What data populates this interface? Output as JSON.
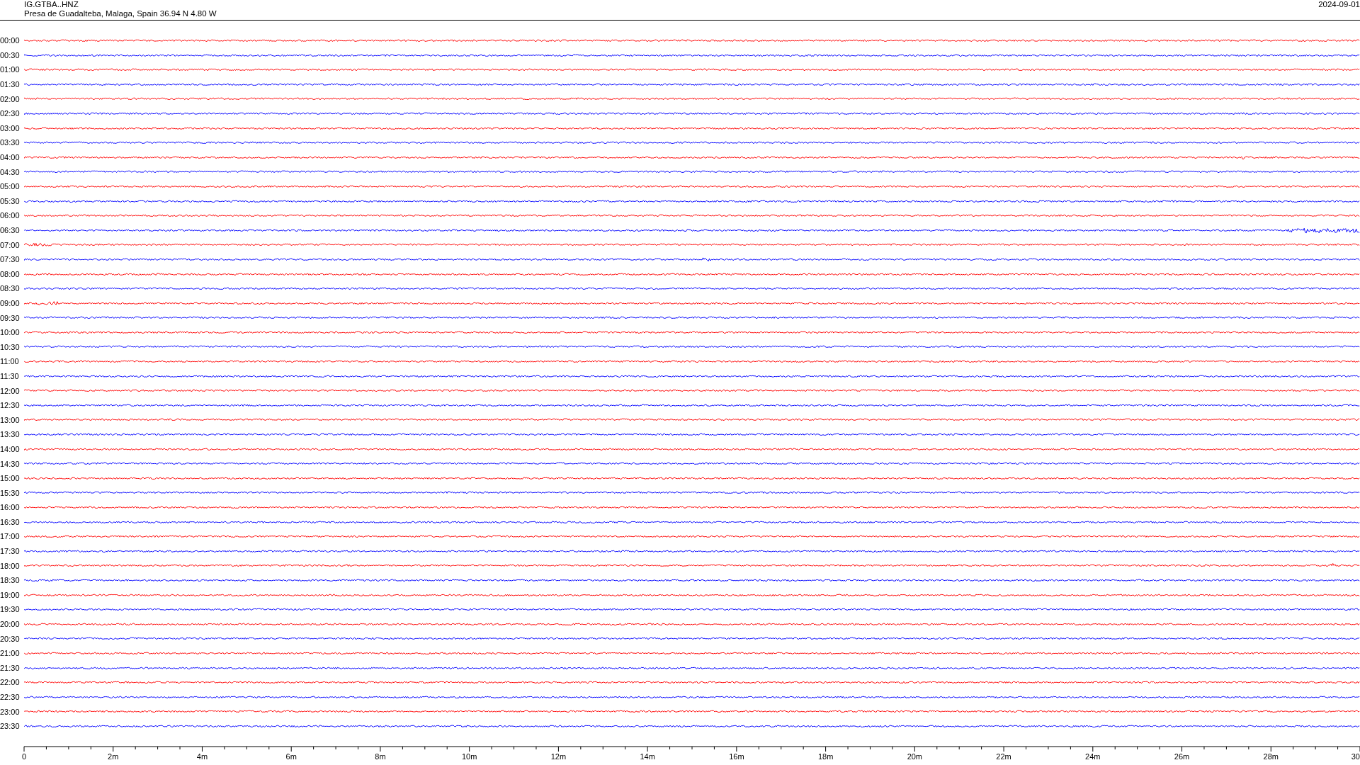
{
  "header": {
    "station": "IG.GTBA..HNZ",
    "location": "Presa de Guadalteba, Malaga, Spain  36.94 N 4.80 W",
    "date": "2024-09-01"
  },
  "traces": [
    {
      "time": "00:00",
      "color": "#ff0000"
    },
    {
      "time": "00:30",
      "color": "#0000ff"
    },
    {
      "time": "01:00",
      "color": "#ff0000"
    },
    {
      "time": "01:30",
      "color": "#0000ff"
    },
    {
      "time": "02:00",
      "color": "#ff0000"
    },
    {
      "time": "02:30",
      "color": "#0000ff"
    },
    {
      "time": "03:00",
      "color": "#ff0000"
    },
    {
      "time": "03:30",
      "color": "#0000ff"
    },
    {
      "time": "04:00",
      "color": "#ff0000"
    },
    {
      "time": "04:30",
      "color": "#0000ff"
    },
    {
      "time": "05:00",
      "color": "#ff0000"
    },
    {
      "time": "05:30",
      "color": "#0000ff"
    },
    {
      "time": "06:00",
      "color": "#ff0000"
    },
    {
      "time": "06:30",
      "color": "#0000ff"
    },
    {
      "time": "07:00",
      "color": "#ff0000"
    },
    {
      "time": "07:30",
      "color": "#0000ff"
    },
    {
      "time": "08:00",
      "color": "#ff0000"
    },
    {
      "time": "08:30",
      "color": "#0000ff"
    },
    {
      "time": "09:00",
      "color": "#ff0000"
    },
    {
      "time": "09:30",
      "color": "#0000ff"
    },
    {
      "time": "10:00",
      "color": "#ff0000"
    },
    {
      "time": "10:30",
      "color": "#0000ff"
    },
    {
      "time": "11:00",
      "color": "#ff0000"
    },
    {
      "time": "11:30",
      "color": "#0000ff"
    },
    {
      "time": "12:00",
      "color": "#ff0000"
    },
    {
      "time": "12:30",
      "color": "#0000ff"
    },
    {
      "time": "13:00",
      "color": "#ff0000"
    },
    {
      "time": "13:30",
      "color": "#0000ff"
    },
    {
      "time": "14:00",
      "color": "#ff0000"
    },
    {
      "time": "14:30",
      "color": "#0000ff"
    },
    {
      "time": "15:00",
      "color": "#ff0000"
    },
    {
      "time": "15:30",
      "color": "#0000ff"
    },
    {
      "time": "16:00",
      "color": "#ff0000"
    },
    {
      "time": "16:30",
      "color": "#0000ff"
    },
    {
      "time": "17:00",
      "color": "#ff0000"
    },
    {
      "time": "17:30",
      "color": "#0000ff"
    },
    {
      "time": "18:00",
      "color": "#ff0000"
    },
    {
      "time": "18:30",
      "color": "#0000ff"
    },
    {
      "time": "19:00",
      "color": "#ff0000"
    },
    {
      "time": "19:30",
      "color": "#0000ff"
    },
    {
      "time": "20:00",
      "color": "#ff0000"
    },
    {
      "time": "20:30",
      "color": "#0000ff"
    },
    {
      "time": "21:00",
      "color": "#ff0000"
    },
    {
      "time": "21:30",
      "color": "#0000ff"
    },
    {
      "time": "22:00",
      "color": "#ff0000"
    },
    {
      "time": "22:30",
      "color": "#0000ff"
    },
    {
      "time": "23:00",
      "color": "#ff0000"
    },
    {
      "time": "23:30",
      "color": "#0000ff"
    }
  ],
  "x_axis": {
    "labels": [
      "0",
      "2m",
      "4m",
      "6m",
      "8m",
      "10m",
      "12m",
      "14m",
      "16m",
      "18m",
      "20m",
      "22m",
      "24m",
      "26m",
      "28m",
      "30"
    ]
  }
}
